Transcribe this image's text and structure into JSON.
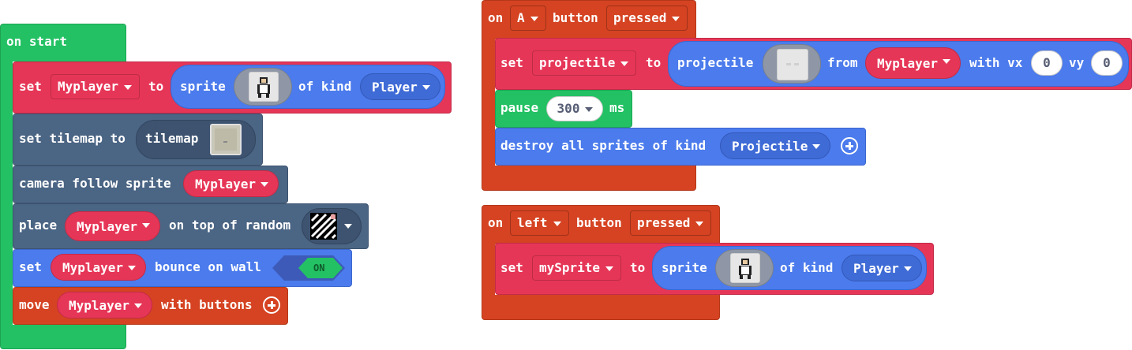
{
  "on_start": {
    "hat_label": "on start",
    "set_player": {
      "set": "set",
      "variable": "Myplayer",
      "to": "to",
      "sprite": "sprite",
      "of_kind": "of kind",
      "kind": "Player"
    },
    "set_tilemap": {
      "label": "set tilemap to",
      "tilemap": "tilemap"
    },
    "camera": {
      "label": "camera follow sprite",
      "variable": "Myplayer"
    },
    "place": {
      "place": "place",
      "variable": "Myplayer",
      "on_top": "on top of random"
    },
    "bounce": {
      "set": "set",
      "variable": "Myplayer",
      "bounce": "bounce on wall",
      "toggle": "ON"
    },
    "move": {
      "move": "move",
      "variable": "Myplayer",
      "with_buttons": "with buttons"
    }
  },
  "on_a": {
    "on": "on",
    "button": "A",
    "button_label": "button",
    "event": "pressed",
    "set_projectile": {
      "set": "set",
      "variable": "projectile",
      "to": "to",
      "projectile": "projectile",
      "from": "from",
      "source": "Myplayer",
      "with_vx": "with vx",
      "vx": "0",
      "vy_label": "vy",
      "vy": "0"
    },
    "pause": {
      "pause": "pause",
      "value": "300",
      "ms": "ms"
    },
    "destroy": {
      "label": "destroy all sprites of kind",
      "kind": "Projectile"
    }
  },
  "on_left": {
    "on": "on",
    "button": "left",
    "button_label": "button",
    "event": "pressed",
    "set_sprite": {
      "set": "set",
      "variable": "mySprite",
      "to": "to",
      "sprite": "sprite",
      "of_kind": "of kind",
      "kind": "Player"
    }
  },
  "colors": {
    "loops_green": "#23c163",
    "sprites_red": "#e63657",
    "sprites_blue": "#4b7bec",
    "scene_slate": "#4b6584",
    "controller_orange": "#d54322",
    "variable_dd": "#e63657",
    "kind_dd": "#3f6bd6"
  }
}
